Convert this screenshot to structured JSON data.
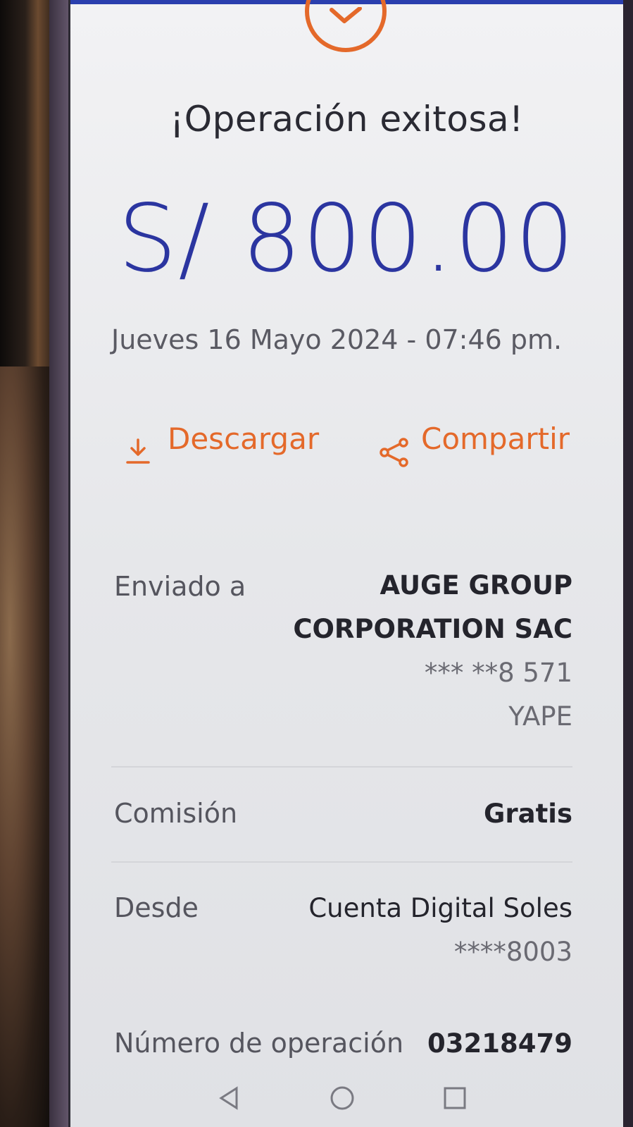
{
  "header": {
    "title": "¡Operación exitosa!",
    "amount": "S/ 800.00",
    "datetime": "Jueves 16 Mayo 2024 - 07:46 pm."
  },
  "actions": {
    "download_label": "Descargar",
    "share_label": "Compartir"
  },
  "details": {
    "sent_to": {
      "label": "Enviado a",
      "name_line1": "AUGE GROUP",
      "name_line2": "CORPORATION SAC",
      "number": "*** **8 571",
      "channel": "YAPE"
    },
    "commission": {
      "label": "Comisión",
      "value": "Gratis"
    },
    "from": {
      "label": "Desde",
      "account": "Cuenta Digital Soles",
      "number": "****8003"
    },
    "operation": {
      "label": "Número de operación",
      "value": "03218479"
    }
  },
  "icons": {
    "success": "checkmark-circle-icon",
    "download": "download-icon",
    "share": "share-icon",
    "nav_back": "back-triangle-icon",
    "nav_home": "home-circle-icon",
    "nav_recents": "recents-square-icon"
  },
  "colors": {
    "accent": "#e4692a",
    "amount": "#2b35a0",
    "topbar": "#2a3fae"
  }
}
